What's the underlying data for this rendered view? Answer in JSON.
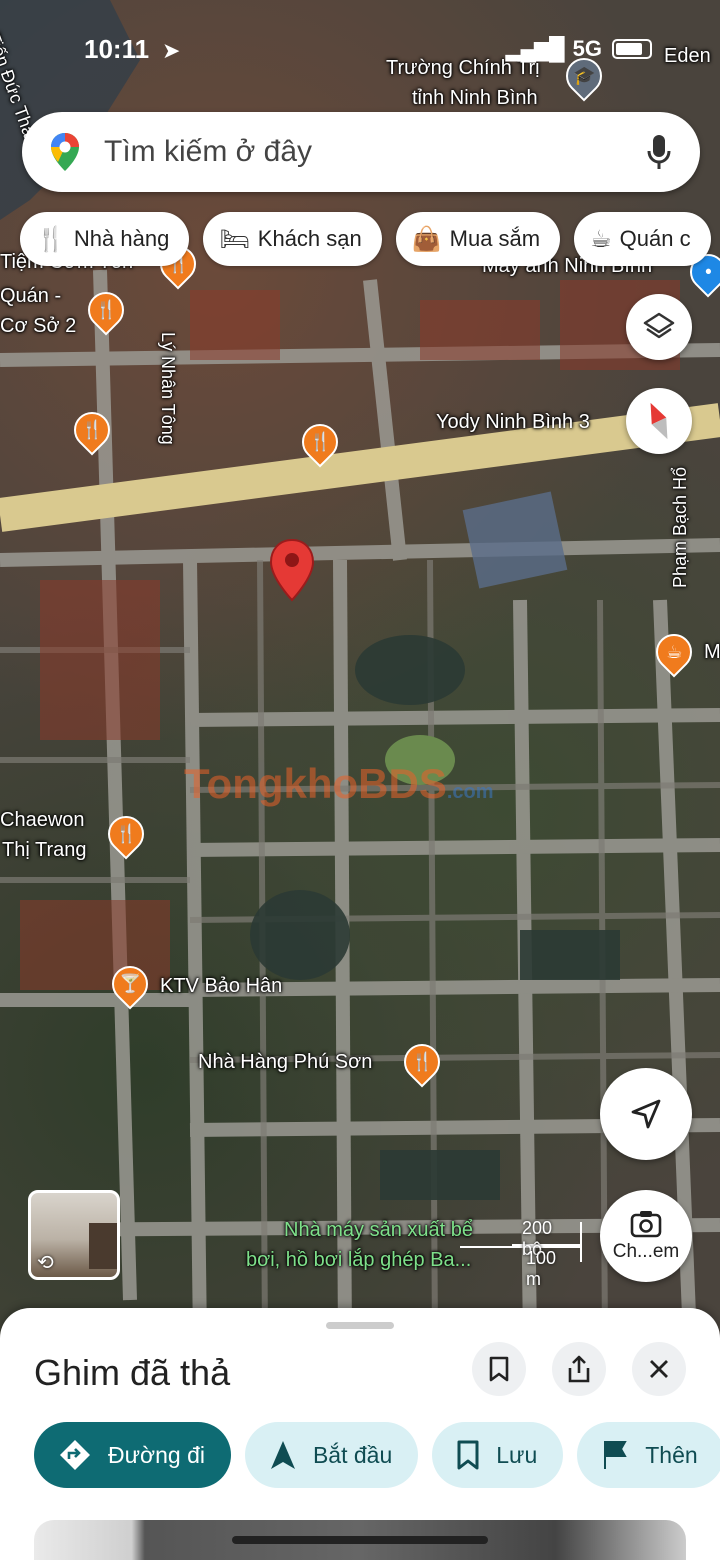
{
  "status_bar": {
    "time": "10:11",
    "network": "5G"
  },
  "search": {
    "placeholder": "Tìm kiếm ở đây",
    "logo_icon": "google-maps-pin-icon",
    "voice_icon": "mic-icon"
  },
  "chips": [
    {
      "label": "Nhà hàng",
      "icon": "fork-knife-icon"
    },
    {
      "label": "Khách sạn",
      "icon": "bed-icon"
    },
    {
      "label": "Mua sắm",
      "icon": "shopping-bag-icon"
    },
    {
      "label": "Quán c",
      "icon": "coffee-cup-icon"
    }
  ],
  "map_labels": {
    "eden": "Eden",
    "truong_line1": "Trường Chính Trị",
    "truong_line2": "tỉnh Ninh Bình",
    "tien_duc": "Tiến Đức Thắn",
    "tiem_com": "Tiệm Cơm Tôn",
    "quan_line1": "Quán -",
    "quan_line2": "Cơ Sở 2",
    "may_anh": "Máy ảnh Ninh Bình",
    "ly_nhan_tong": "Lý Nhân Tông",
    "yody": "Yody Ninh Bình 3",
    "pham_bach_ho": "Phạm Bạch Hổ",
    "m": "M",
    "chaewon_line1": "Chaewon",
    "chaewon_line2": "Thị Trang",
    "ktv": "KTV Bảo Hân",
    "nha_hang_phu_son": "Nhà Hàng Phú Sơn",
    "nha_may_line1": "Nhà máy sản xuất bể",
    "nha_may_line2": "bơi, hồ bơi lắp ghép Ba...",
    "watermark": "TongkhoBDS",
    "watermark_suffix": ".com"
  },
  "scale": {
    "imperial": "200 bộ",
    "metric": "100 m"
  },
  "camera_button_label": "Ch...em",
  "sheet": {
    "title": "Ghim đã thả",
    "actions": [
      {
        "label": "Đường đi",
        "icon": "directions-icon"
      },
      {
        "label": "Bắt đầu",
        "icon": "navigation-arrow-icon"
      },
      {
        "label": "Lưu",
        "icon": "bookmark-icon"
      },
      {
        "label": "Thên",
        "icon": "flag-icon"
      }
    ]
  },
  "colors": {
    "poi_orange": "#f07b1d",
    "pin_red": "#e53935",
    "primary_teal": "#0e6b73",
    "secondary_chip": "#d9f0f4"
  }
}
